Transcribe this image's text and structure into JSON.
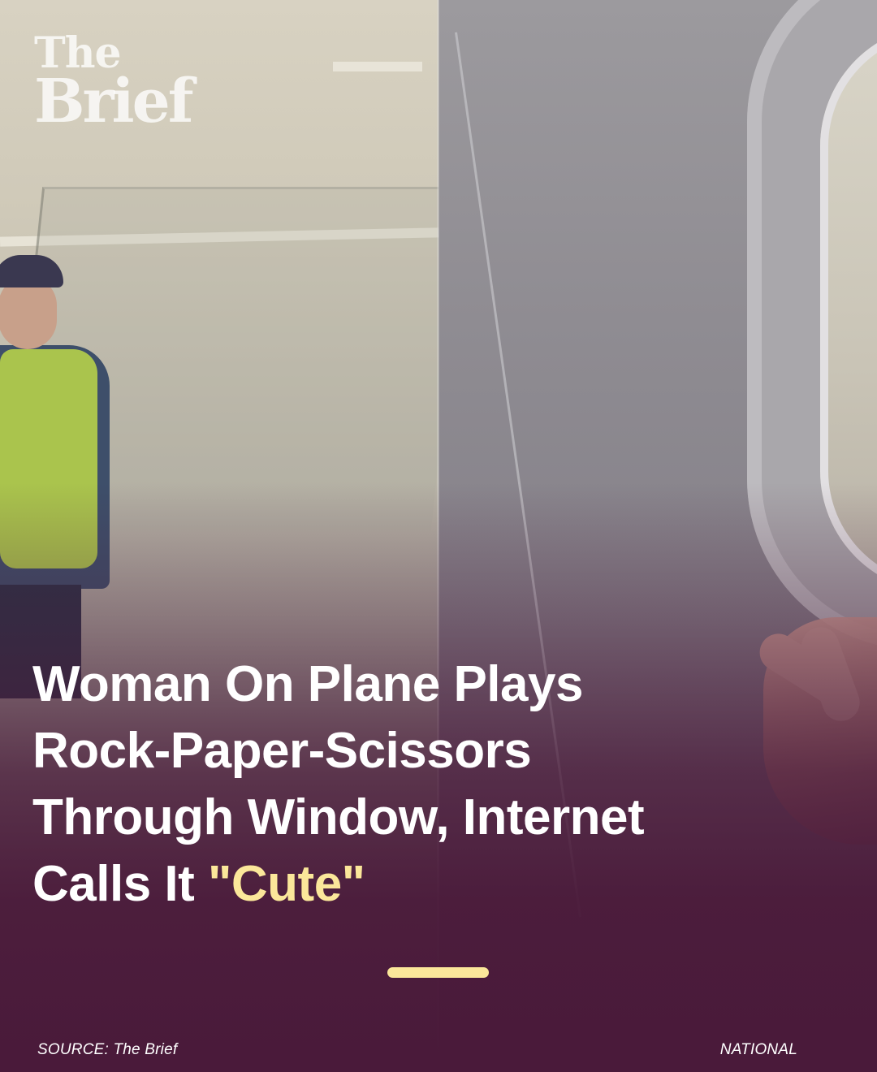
{
  "brand": {
    "logo_line1": "The",
    "logo_line2": "Brief"
  },
  "headline": {
    "line1": "Woman On Plane Plays",
    "line2": "Rock-Paper-Scissors",
    "line3": "Through Window, Internet",
    "line4_prefix": "Calls It ",
    "line4_highlight": "\"Cute\""
  },
  "footer": {
    "source": "SOURCE: The Brief",
    "category": "NATIONAL"
  },
  "colors": {
    "background": "#4a1a3a",
    "highlight": "#fbe79a",
    "accent_bar": "#fbe79a",
    "text": "#ffffff"
  }
}
